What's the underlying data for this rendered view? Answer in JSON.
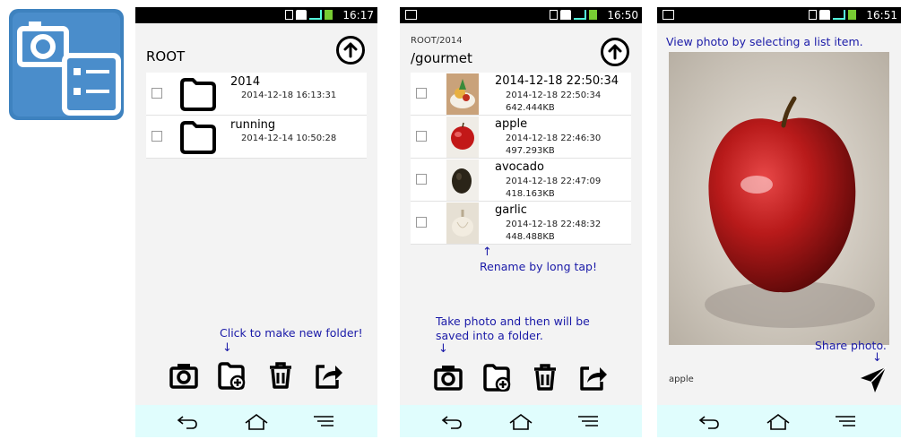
{
  "screen1": {
    "status_time": "16:17",
    "path_title": "ROOT",
    "items": [
      {
        "name": "2014",
        "date": "2014-12-18 16:13:31"
      },
      {
        "name": "running",
        "date": "2014-12-14 10:50:28"
      }
    ],
    "note": "Click to make new folder!",
    "arrow": "↓"
  },
  "screen2": {
    "status_time": "16:50",
    "path_parent": "ROOT/2014",
    "path_title": "/gourmet",
    "items": [
      {
        "name": "2014-12-18 22:50:34",
        "date": "2014-12-18 22:50:34",
        "size": "642.444KB"
      },
      {
        "name": "apple",
        "date": "2014-12-18 22:46:30",
        "size": "497.293KB"
      },
      {
        "name": "avocado",
        "date": "2014-12-18 22:47:09",
        "size": "418.163KB"
      },
      {
        "name": "garlic",
        "date": "2014-12-18 22:48:32",
        "size": "448.488KB"
      }
    ],
    "rename_arrow": "↑",
    "rename_note": "Rename by long tap!",
    "note_line1": "Take photo and then will be",
    "note_line2": "saved into a folder.",
    "arrow": "↓"
  },
  "screen3": {
    "status_time": "16:51",
    "top_note": "View photo by selecting a list item.",
    "share_note": "Share photo.",
    "arrow": "↓",
    "caption": "apple"
  },
  "colors": {
    "annotation": "#1a1aa8",
    "navbar": "#e0fdfd",
    "app_icon": "#3e82bf"
  },
  "icons": [
    "camera-icon",
    "new-folder-icon",
    "trash-icon",
    "share-icon",
    "up-arrow-icon",
    "send-icon",
    "back-icon",
    "home-icon",
    "menu-icon",
    "folder-icon"
  ]
}
